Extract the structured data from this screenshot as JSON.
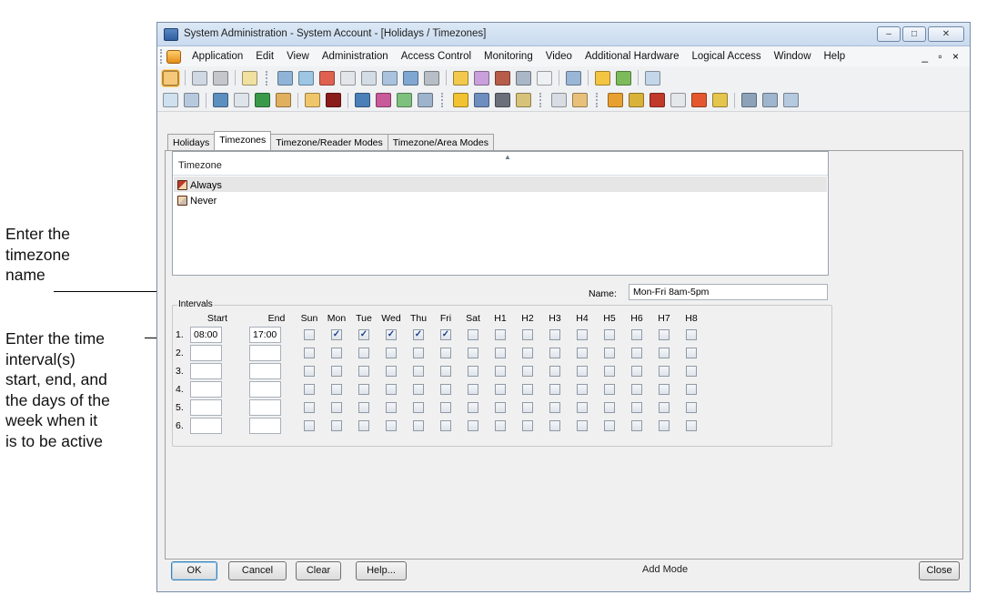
{
  "annotations": {
    "name_callout": [
      "Enter the",
      "timezone",
      "name"
    ],
    "interval_callout": [
      "Enter the time",
      "interval(s)",
      "start, end, and",
      "the days of the",
      "week when it",
      "is to be active"
    ]
  },
  "window": {
    "title": "System Administration - System Account - [Holidays / Timezones]",
    "controls": [
      "–",
      "□",
      "✕"
    ]
  },
  "menubar": {
    "items": [
      "Application",
      "Edit",
      "View",
      "Administration",
      "Access Control",
      "Monitoring",
      "Video",
      "Additional Hardware",
      "Logical Access",
      "Window",
      "Help"
    ],
    "mdi_controls": "_ ▫ ×"
  },
  "tabs": [
    "Holidays",
    "Timezones",
    "Timezone/Reader Modes",
    "Timezone/Area Modes"
  ],
  "timezone_list": {
    "header": "Timezone",
    "rows": [
      "Always",
      "Never"
    ],
    "selected_index": 0
  },
  "name_field": {
    "label": "Name:",
    "value": "Mon-Fri 8am-5pm"
  },
  "intervals": {
    "group_label": "Intervals",
    "columns": [
      "Start",
      "End",
      "Sun",
      "Mon",
      "Tue",
      "Wed",
      "Thu",
      "Fri",
      "Sat",
      "H1",
      "H2",
      "H3",
      "H4",
      "H5",
      "H6",
      "H7",
      "H8"
    ],
    "rows": [
      {
        "num": "1.",
        "start": "08:00",
        "end": "17:00",
        "checked": [
          false,
          true,
          true,
          true,
          true,
          true,
          false,
          false,
          false,
          false,
          false,
          false,
          false,
          false,
          false
        ]
      },
      {
        "num": "2.",
        "start": "",
        "end": "",
        "checked": [
          false,
          false,
          false,
          false,
          false,
          false,
          false,
          false,
          false,
          false,
          false,
          false,
          false,
          false,
          false
        ]
      },
      {
        "num": "3.",
        "start": "",
        "end": "",
        "checked": [
          false,
          false,
          false,
          false,
          false,
          false,
          false,
          false,
          false,
          false,
          false,
          false,
          false,
          false,
          false
        ]
      },
      {
        "num": "4.",
        "start": "",
        "end": "",
        "checked": [
          false,
          false,
          false,
          false,
          false,
          false,
          false,
          false,
          false,
          false,
          false,
          false,
          false,
          false,
          false
        ]
      },
      {
        "num": "5.",
        "start": "",
        "end": "",
        "checked": [
          false,
          false,
          false,
          false,
          false,
          false,
          false,
          false,
          false,
          false,
          false,
          false,
          false,
          false,
          false
        ]
      },
      {
        "num": "6.",
        "start": "",
        "end": "",
        "checked": [
          false,
          false,
          false,
          false,
          false,
          false,
          false,
          false,
          false,
          false,
          false,
          false,
          false,
          false,
          false
        ]
      }
    ]
  },
  "buttons": {
    "ok": "OK",
    "cancel": "Cancel",
    "clear": "Clear",
    "help": "Help...",
    "close": "Close"
  },
  "status_text": "Add Mode",
  "colors": {
    "accent": "#3c7fb1",
    "checkmark": "#1b3f8f",
    "selection": "#e6e6e6"
  }
}
